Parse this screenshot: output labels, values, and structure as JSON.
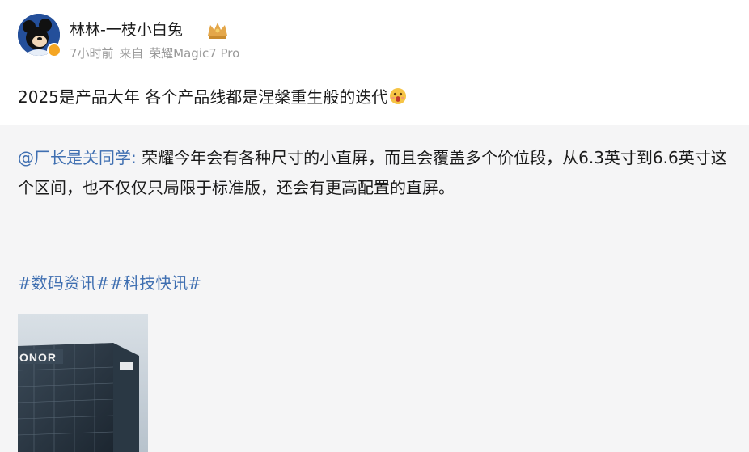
{
  "post": {
    "author": "林林-一枝小白兔",
    "time": "7小时前",
    "source_prefix": "来自",
    "source_device": "荣耀Magic7 Pro",
    "text": "2025是产品大年 各个产品线都是涅槃重生般的迭代"
  },
  "repost": {
    "mention": "@厂长是关同学:",
    "body": " 荣耀今年会有各种尺寸的小直屏，而且会覆盖多个价位段，从6.3英寸到6.6英寸这个区间，也不仅仅只局限于标准版，还会有更高配置的直屏。",
    "hashtags": "#数码资讯##科技快讯#",
    "image_sign_text": "ONOR"
  },
  "colors": {
    "link": "#3f6fb1",
    "meta_gray": "#9a9a9a",
    "repost_bg": "#f5f5f6",
    "badge": "#f5a623"
  },
  "icons": [
    "avatar",
    "verified-badge-icon",
    "crown-icon",
    "surprised-face-emoji-icon"
  ]
}
